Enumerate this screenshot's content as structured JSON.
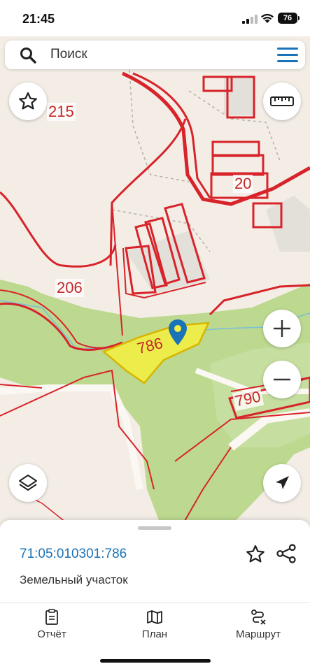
{
  "status_bar": {
    "time": "21:45",
    "battery": "76"
  },
  "search": {
    "placeholder": "Поиск"
  },
  "map": {
    "labels": {
      "p215": "215",
      "p20": "20",
      "p206": "206",
      "p786": "786",
      "p790": "790"
    },
    "colors": {
      "background": "#f3ede6",
      "forest": "#bcd98f",
      "boundary": "#d8232a",
      "selected_fill": "#f1ee44",
      "selected_outline": "#d9b400",
      "pin": "#1a73b8"
    }
  },
  "parcel": {
    "number": "71:05:010301:786",
    "type": "Земельный участок"
  },
  "tabs": [
    {
      "label": "Отчёт",
      "icon": "report-icon"
    },
    {
      "label": "План",
      "icon": "map-icon"
    },
    {
      "label": "Маршрут",
      "icon": "route-icon"
    }
  ]
}
